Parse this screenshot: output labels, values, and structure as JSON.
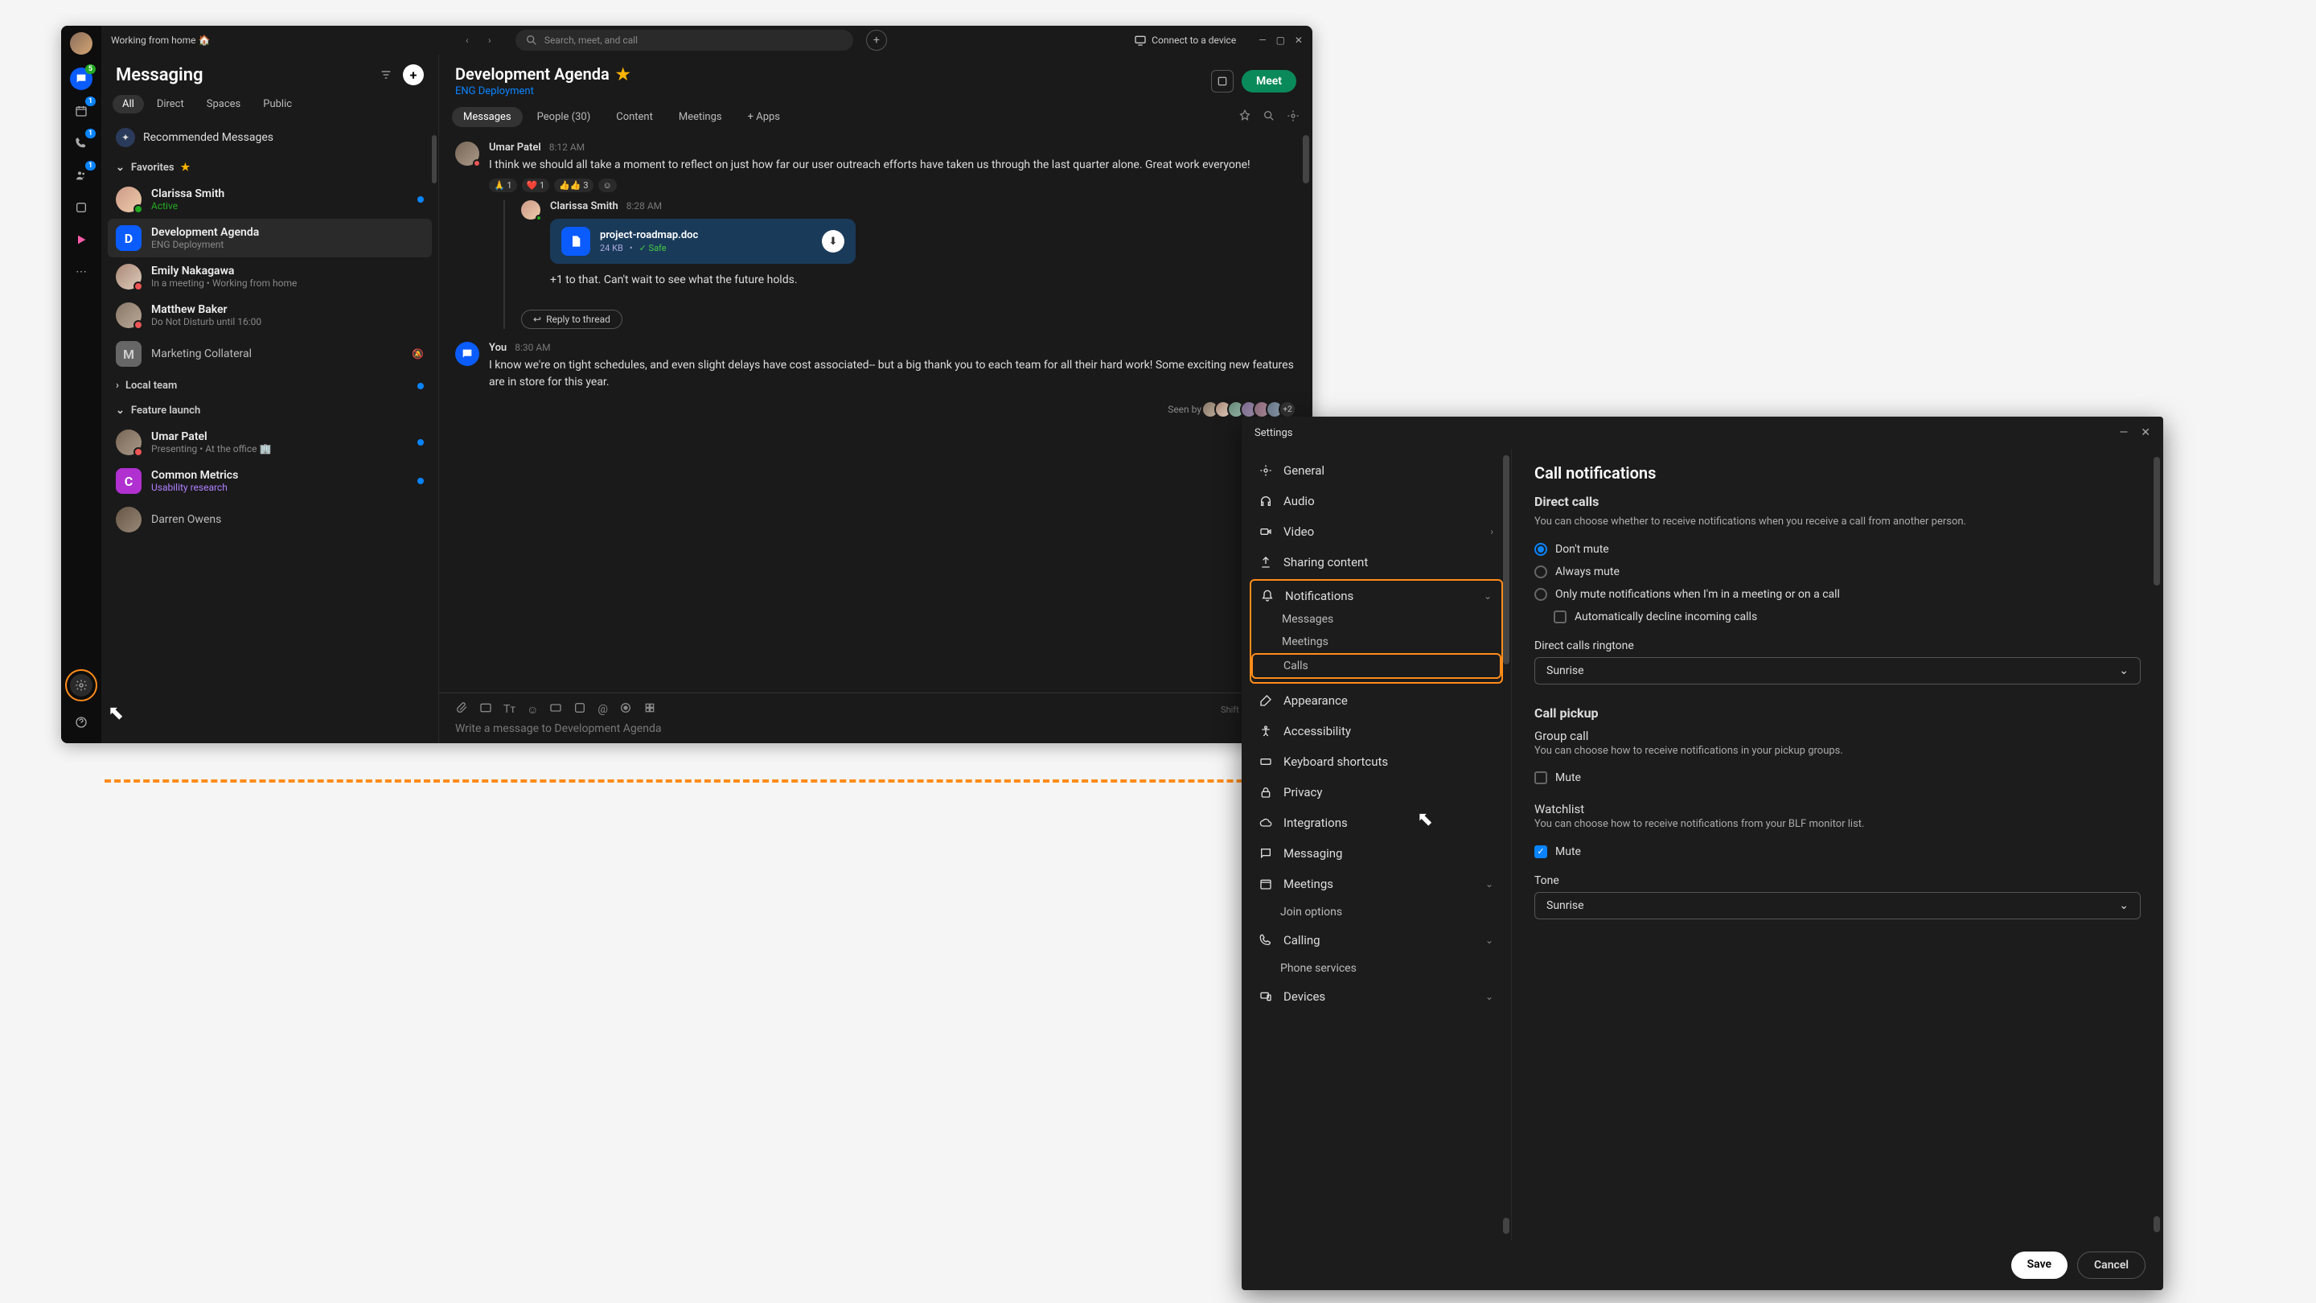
{
  "topbar": {
    "status": "Working from home 🏠",
    "search_placeholder": "Search, meet, and call",
    "connect": "Connect to a device"
  },
  "rail": {
    "badges": {
      "chat": "5",
      "cal": "1",
      "call": "1",
      "team": "1"
    }
  },
  "sidebar": {
    "title": "Messaging",
    "tabs": [
      "All",
      "Direct",
      "Spaces",
      "Public"
    ],
    "recommended": "Recommended Messages",
    "sections": {
      "favorites": "Favorites",
      "local_team": "Local team",
      "feature_launch": "Feature launch"
    },
    "items": [
      {
        "name": "Clarissa Smith",
        "sub": "Active",
        "sub_class": "green"
      },
      {
        "name": "Development Agenda",
        "sub": "ENG Deployment",
        "sel": true,
        "sq": true,
        "letter": "D"
      },
      {
        "name": "Emily Nakagawa",
        "sub": "In a meeting  •  Working from home"
      },
      {
        "name": "Matthew Baker",
        "sub": "Do Not Disturb until 16:00"
      },
      {
        "name": "Marketing Collateral",
        "sub": "",
        "sq": true,
        "letter": "M",
        "muted": true
      },
      {
        "name": "Umar Patel",
        "sub": "Presenting  •  At the office 🏢"
      },
      {
        "name": "Common Metrics",
        "sub": "Usability research",
        "sub_class": "purple",
        "sq": true,
        "letter": "C"
      },
      {
        "name": "Darren Owens",
        "sub": ""
      }
    ]
  },
  "content": {
    "title": "Development Agenda",
    "subtitle": "ENG Deployment",
    "meet": "Meet",
    "tabs": [
      "Messages",
      "People (30)",
      "Content",
      "Meetings"
    ],
    "add_apps": "+  Apps",
    "messages": [
      {
        "author": "Umar Patel",
        "time": "8:12 AM",
        "text": "I think we should all take a moment to reflect on just how far our user outreach efforts have taken us through the last quarter alone. Great work everyone!",
        "reactions": [
          "🙏 1",
          "❤️ 1",
          "👍👍 3"
        ]
      },
      {
        "author": "Clarissa Smith",
        "time": "8:28 AM",
        "thread": true,
        "file": {
          "name": "project-roadmap.doc",
          "size": "24 KB",
          "safe": "Safe"
        },
        "text": "+1 to that. Can't wait to see what the future holds."
      },
      {
        "author_you": "You",
        "time": "8:30 AM",
        "text": "I know we're on tight schedules, and even slight delays have cost associated-- but a big thank you to each team for all their hard work! Some exciting new features are in store for this year."
      }
    ],
    "reply_thread": "Reply to thread",
    "seen_by": "Seen by",
    "seen_more": "+2",
    "composer": {
      "hint": "Shift + Enter for a n",
      "placeholder": "Write a message to Development Agenda"
    }
  },
  "settings": {
    "title": "Settings",
    "nav": [
      "General",
      "Audio",
      "Video",
      "Sharing content",
      "Notifications",
      "Appearance",
      "Accessibility",
      "Keyboard shortcuts",
      "Privacy",
      "Integrations",
      "Messaging",
      "Meetings",
      "Calling",
      "Devices"
    ],
    "notif_subs": [
      "Messages",
      "Meetings",
      "Calls"
    ],
    "meetings_subs": [
      "Join options"
    ],
    "calling_subs": [
      "Phone services"
    ],
    "panel": {
      "title": "Call notifications",
      "direct": {
        "h": "Direct calls",
        "desc": "You can choose whether to receive notifications when you receive a call from another person.",
        "opts": [
          "Don't mute",
          "Always mute",
          "Only mute notifications when I'm in a meeting or on a call"
        ],
        "auto_decline": "Automatically decline incoming calls",
        "ringtone_label": "Direct calls ringtone",
        "ringtone": "Sunrise"
      },
      "pickup": {
        "h": "Call pickup",
        "group": "Group call",
        "group_desc": "You can choose how to receive notifications in your pickup groups.",
        "mute": "Mute",
        "watchlist": "Watchlist",
        "watchlist_desc": "You can choose how to receive notifications from your BLF monitor list.",
        "tone_label": "Tone",
        "tone": "Sunrise"
      }
    },
    "save": "Save",
    "cancel": "Cancel"
  }
}
